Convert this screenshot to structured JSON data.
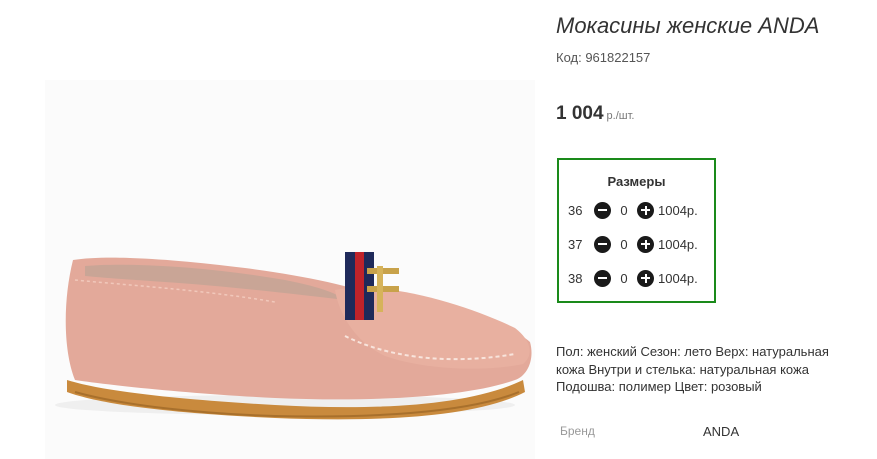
{
  "product": {
    "title": "Мокасины женские ANDA",
    "code_label": "Код: 961822157",
    "price": "1 004",
    "price_unit": "р./шт.",
    "description": "Пол: женский Сезон: лето Верх: натуральная кожа Внутри и стелька: натуральная кожа Подошва: полимер Цвет: розовый",
    "brand_label": "Бренд",
    "brand_value": "ANDA"
  },
  "sizes": {
    "title": "Размеры",
    "rows": [
      {
        "size": "36",
        "qty": "0",
        "price": "1004р."
      },
      {
        "size": "37",
        "qty": "0",
        "price": "1004р."
      },
      {
        "size": "38",
        "qty": "0",
        "price": "1004р."
      }
    ]
  },
  "icons": {
    "minus": "minus-circle-icon",
    "plus": "plus-circle-icon"
  },
  "colors": {
    "accent_border": "#1a8a1a",
    "shoe": "#e3a99a",
    "sole": "#c98a3d"
  }
}
